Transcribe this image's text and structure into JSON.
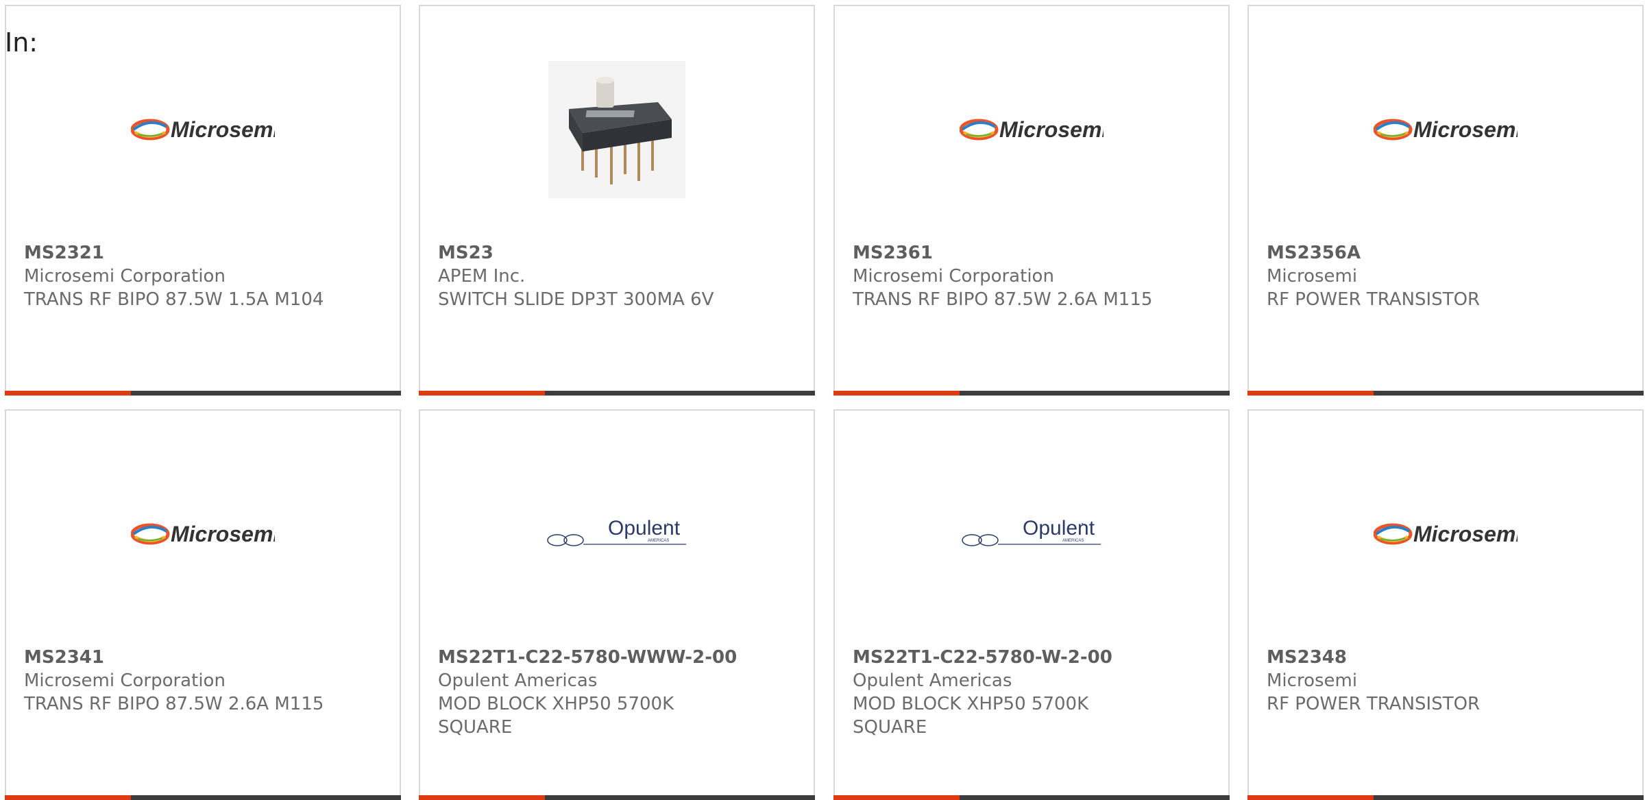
{
  "filter_label": "In:",
  "colors": {
    "accent": "#e03a12",
    "bar": "#3c3c3c",
    "text": "#6b6b6b",
    "border": "#d9d9d9"
  },
  "products": [
    {
      "part_number": "MS2321",
      "manufacturer": "Microsemi Corporation",
      "description": "TRANS RF BIPO 87.5W 1.5A M104",
      "image": "microsemi-logo",
      "logo_text": "Microsemi"
    },
    {
      "part_number": "MS23",
      "manufacturer": "APEM Inc.",
      "description": "SWITCH SLIDE DP3T 300MA 6V",
      "image": "slide-switch-photo",
      "logo_text": ""
    },
    {
      "part_number": "MS2361",
      "manufacturer": "Microsemi Corporation",
      "description": "TRANS RF BIPO 87.5W 2.6A M115",
      "image": "microsemi-logo",
      "logo_text": "Microsemi"
    },
    {
      "part_number": "MS2356A",
      "manufacturer": "Microsemi",
      "description": "RF POWER TRANSISTOR",
      "image": "microsemi-logo",
      "logo_text": "Microsemi"
    },
    {
      "part_number": "MS2341",
      "manufacturer": "Microsemi Corporation",
      "description": "TRANS RF BIPO 87.5W 2.6A M115",
      "image": "microsemi-logo",
      "logo_text": "Microsemi"
    },
    {
      "part_number": "MS22T1-C22-5780-WWW-2-00",
      "manufacturer": "Opulent Americas",
      "description": "MOD BLOCK XHP50 5700K SQUARE",
      "image": "opulent-logo",
      "logo_text": "Opulent"
    },
    {
      "part_number": "MS22T1-C22-5780-W-2-00",
      "manufacturer": "Opulent Americas",
      "description": "MOD BLOCK XHP50 5700K SQUARE",
      "image": "opulent-logo",
      "logo_text": "Opulent"
    },
    {
      "part_number": "MS2348",
      "manufacturer": "Microsemi",
      "description": "RF POWER TRANSISTOR",
      "image": "microsemi-logo",
      "logo_text": "Microsemi"
    }
  ]
}
